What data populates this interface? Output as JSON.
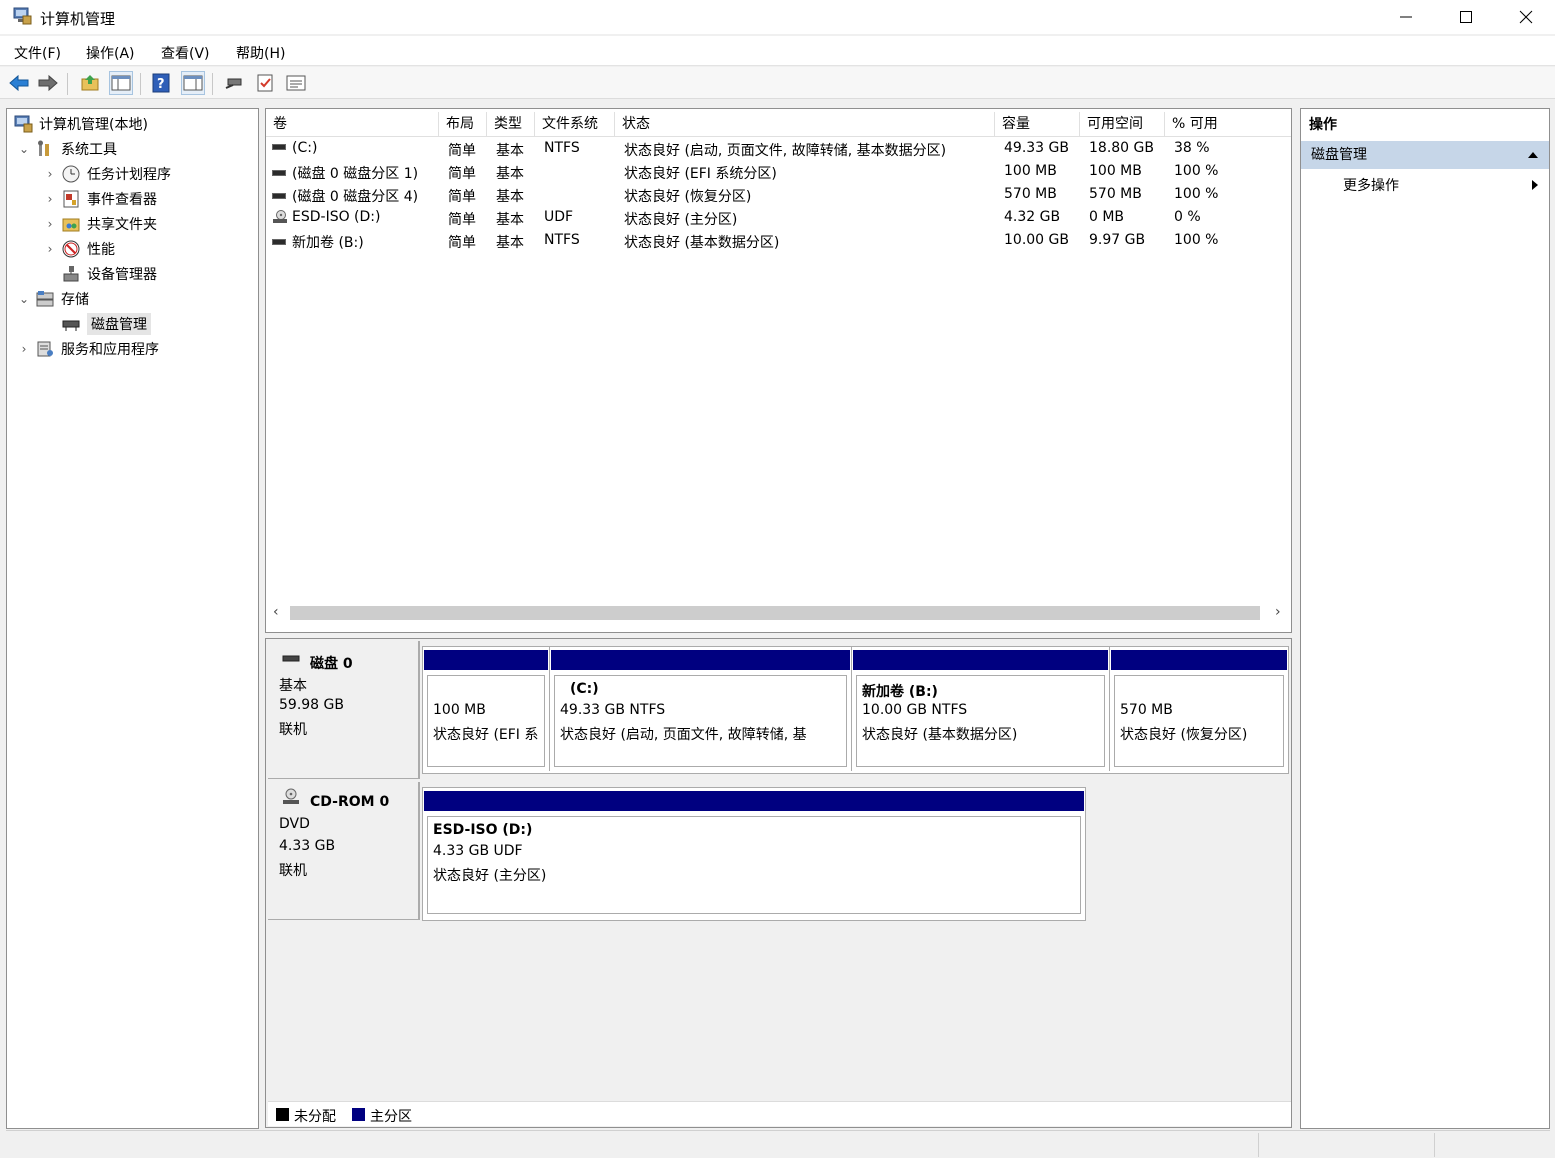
{
  "window": {
    "title": "计算机管理"
  },
  "menu": [
    "文件(F)",
    "操作(A)",
    "查看(V)",
    "帮助(H)"
  ],
  "toolbar": {
    "icons": [
      "back-icon",
      "forward-icon",
      "up-folder-icon",
      "show-tree-icon",
      "help-icon",
      "show-actions-icon",
      "connect-icon",
      "properties-icon",
      "list-view-icon"
    ]
  },
  "tree": {
    "root": "计算机管理(本地)",
    "system_tools": "系统工具",
    "task_scheduler": "任务计划程序",
    "event_viewer": "事件查看器",
    "shared_folders": "共享文件夹",
    "performance": "性能",
    "device_manager": "设备管理器",
    "storage": "存储",
    "disk_management": "磁盘管理",
    "services_apps": "服务和应用程序"
  },
  "volumes": {
    "headers": [
      "卷",
      "布局",
      "类型",
      "文件系统",
      "状态",
      "容量",
      "可用空间",
      "% 可用"
    ],
    "rows": [
      {
        "name": "(C:)",
        "layout": "简单",
        "type": "基本",
        "fs": "NTFS",
        "status": "状态良好 (启动, 页面文件, 故障转储, 基本数据分区)",
        "capacity": "49.33 GB",
        "free": "18.80 GB",
        "pct": "38 %"
      },
      {
        "name": "(磁盘 0 磁盘分区 1)",
        "layout": "简单",
        "type": "基本",
        "fs": "",
        "status": "状态良好 (EFI 系统分区)",
        "capacity": "100 MB",
        "free": "100 MB",
        "pct": "100 %"
      },
      {
        "name": "(磁盘 0 磁盘分区 4)",
        "layout": "简单",
        "type": "基本",
        "fs": "",
        "status": "状态良好 (恢复分区)",
        "capacity": "570 MB",
        "free": "570 MB",
        "pct": "100 %"
      },
      {
        "name": "ESD-ISO (D:)",
        "layout": "简单",
        "type": "基本",
        "fs": "UDF",
        "status": "状态良好 (主分区)",
        "capacity": "4.32 GB",
        "free": "0 MB",
        "pct": "0 %"
      },
      {
        "name": "新加卷 (B:)",
        "layout": "简单",
        "type": "基本",
        "fs": "NTFS",
        "status": "状态良好 (基本数据分区)",
        "capacity": "10.00 GB",
        "free": "9.97 GB",
        "pct": "100 %"
      }
    ]
  },
  "disk0": {
    "title": "磁盘 0",
    "type": "基本",
    "size": "59.98 GB",
    "state": "联机",
    "partitions": [
      {
        "name": "",
        "size": "100 MB",
        "status": "状态良好 (EFI 系"
      },
      {
        "name": "(C:)",
        "size": "49.33 GB NTFS",
        "status": "状态良好 (启动, 页面文件, 故障转储, 基"
      },
      {
        "name": "新加卷  (B:)",
        "size": "10.00 GB NTFS",
        "status": "状态良好 (基本数据分区)"
      },
      {
        "name": "",
        "size": "570 MB",
        "status": "状态良好 (恢复分区)"
      }
    ]
  },
  "cdrom0": {
    "title": "CD-ROM 0",
    "type": "DVD",
    "size": "4.33 GB",
    "state": "联机",
    "partition": {
      "name": "ESD-ISO  (D:)",
      "size": "4.33 GB UDF",
      "status": "状态良好 (主分区)"
    }
  },
  "legend": [
    {
      "label": "未分配",
      "color": "#000000"
    },
    {
      "label": "主分区",
      "color": "#000080"
    }
  ],
  "actions": {
    "header": "操作",
    "section": "磁盘管理",
    "more": "更多操作"
  },
  "colors": {
    "partition_bar": "#000080",
    "action_section": "#c6d6e8"
  }
}
